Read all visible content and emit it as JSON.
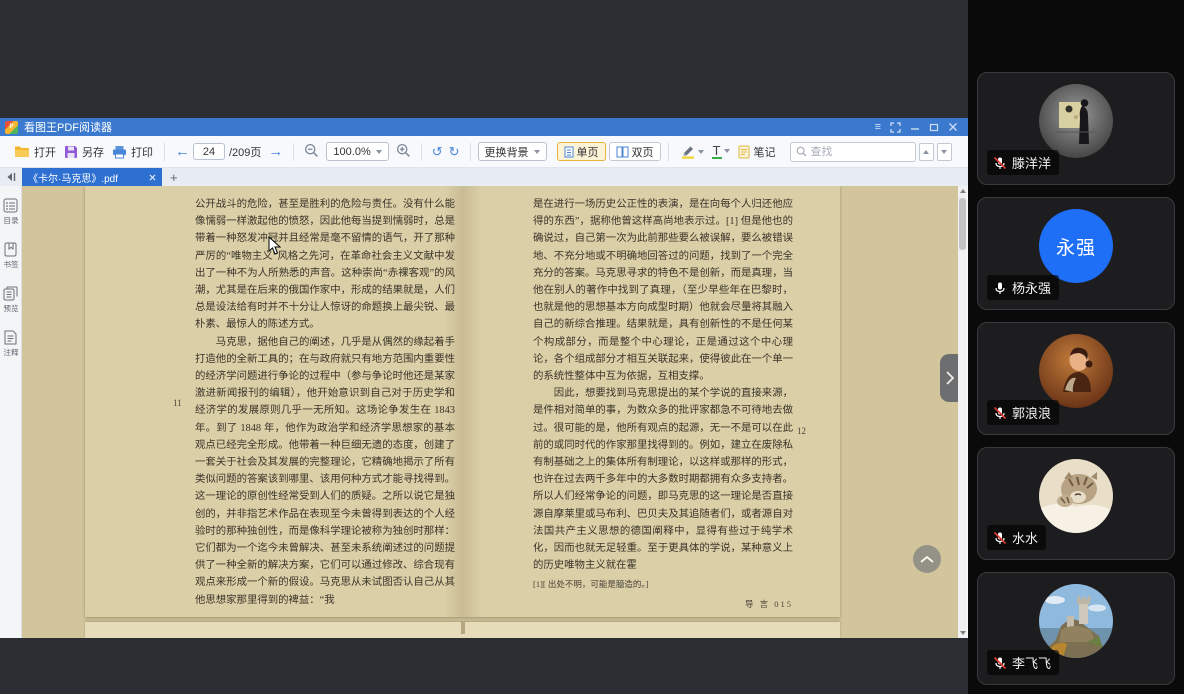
{
  "window": {
    "title": "看图王PDF阅读器",
    "controls": {
      "menu": "menu",
      "fullscreen": "fullscreen",
      "minimize": "minimize",
      "maximize": "maximize",
      "close": "close"
    }
  },
  "toolbar": {
    "open_label": "打开",
    "save_label": "另存",
    "print_label": "打印",
    "page_input": "24",
    "page_total": "/209页",
    "zoom_value": "100.0%",
    "change_bg_label": "更换背景",
    "single_page_label": "单页",
    "double_page_label": "双页",
    "underline_glyph": "T",
    "note_label": "笔记",
    "search_placeholder": "查找"
  },
  "tabbar": {
    "active_tab_title": "《卡尔·马克思》.pdf",
    "new_tab_glyph": "+"
  },
  "sidebar": {
    "items": [
      {
        "label": "目录"
      },
      {
        "label": "书签"
      },
      {
        "label": "预览"
      },
      {
        "label": "注释"
      }
    ]
  },
  "document": {
    "left_page": {
      "margin_number": "11",
      "p1": "公开战斗的危险，甚至是胜利的危险与责任。没有什么能像懦弱一样激起他的愤怒，因此他每当提到懦弱时，总是带着一种怒发冲冠并且经常是毫不留情的语气，开了那种严厉的“唯物主义”风格之先河，在革命社会主义文献中发出了一种不为人所熟悉的声音。这种崇尚“赤裸客观”的风潮，尤其是在后来的俄国作家中，形成的结果就是，人们总是设法给有时并不十分让人惊讶的命题换上最尖锐、最朴素、最惊人的陈述方式。",
      "p2": "马克思，据他自己的阐述，几乎是从偶然的缘起着手打造他的全新工具的；在与政府就只有地方范围内重要性的经济学问题进行争论的过程中（参与争论时他还是某家激进新闻报刊的编辑），他开始意识到自己对于历史学和经济学的发展原则几乎一无所知。这场论争发生在 1843 年。到了 1848 年，他作为政治学和经济学思想家的基本观点已经完全形成。他带着一种巨细无遗的态度，创建了一套关于社会及其发展的完整理论，它精确地揭示了所有类似问题的答案该到哪里、该用何种方式才能寻找得到。这一理论的原创性经常受到人们的质疑。之所以说它是独创的，并非指艺术作品在表现至今未曾得到表达的个人经验时的那种独创性，而是像科学理论被称为独创时那样：它们都为一个迄今未曾解决、甚至未系统阐述过的问题提供了一种全新的解决方案，它们可以通过修改、综合现有观点来形成一个新的假设。马克思从未试图否认自己从其他思想家那里得到的裨益：“我"
    },
    "right_page": {
      "margin_number": "12",
      "p1": "是在进行一场历史公正性的表演，是在向每个人归还他应得的东西”，据称他曾这样高尚地表示过。[1] 但是他也的确说过，自己第一次为此前那些要么被误解，要么被错误地、不充分地或不明确地回答过的问题，找到了一个完全充分的答案。马克思寻求的特色不是创新，而是真理，当他在别人的著作中找到了真理，（至少早些年在巴黎时，也就是他的思想基本方向成型时期）他就会尽量将其融入自己的新综合推理。结果就是，具有创新性的不是任何某个构成部分，而是整个中心理论，正是通过这个中心理论，各个组成部分才相互关联起来，使得彼此在一个单一的系统性整体中互为依据，互相支撑。",
      "p2": "因此，想要找到马克思提出的某个学说的直接来源，是件相对简单的事，为数众多的批评家都急不可待地去做过。很可能的是，他所有观点的起源，无一不是可以在此前的或同时代的作家那里找得到的。例如，建立在废除私有制基础之上的集体所有制理论，以这样或那样的形式，也许在过去两千多年中的大多数时期都拥有众多支持者。所以人们经常争论的问题，即马克思的这一理论是否直接源自摩莱里或马布利、巴贝夫及其追随者们，或者源自对法国共产主义思想的德国阐释中，显得有些过于纯学术化，因而也就无足轻重。至于更具体的学说，某种意义上的历史唯物主义就在霍",
      "footnote": "[1][ 出处不明，可能是臆造的。]",
      "footer": "导 言 015"
    }
  },
  "participants": [
    {
      "name": "滕洋洋",
      "muted": true,
      "avatar": "gallery-photo"
    },
    {
      "name": "杨永强",
      "muted": false,
      "avatar": "blue-initials",
      "avatar_text": "永强"
    },
    {
      "name": "郭浪浪",
      "muted": true,
      "avatar": "portrait-photo"
    },
    {
      "name": "水水",
      "muted": true,
      "avatar": "kitten-photo"
    },
    {
      "name": "李飞飞",
      "muted": true,
      "avatar": "castle-photo"
    }
  ],
  "colors": {
    "titlebar_blue": "#3b79ce",
    "active_tab_blue": "#2e70d2",
    "page_beige": "#dbcfa8",
    "doc_background": "#d2c59c",
    "panel_black": "#0a0a0a",
    "muted_red": "#e03b30",
    "avatar_blue": "#1e6ef6",
    "highlight_yellow": "#f5d327",
    "underline_green": "#37b04c"
  }
}
